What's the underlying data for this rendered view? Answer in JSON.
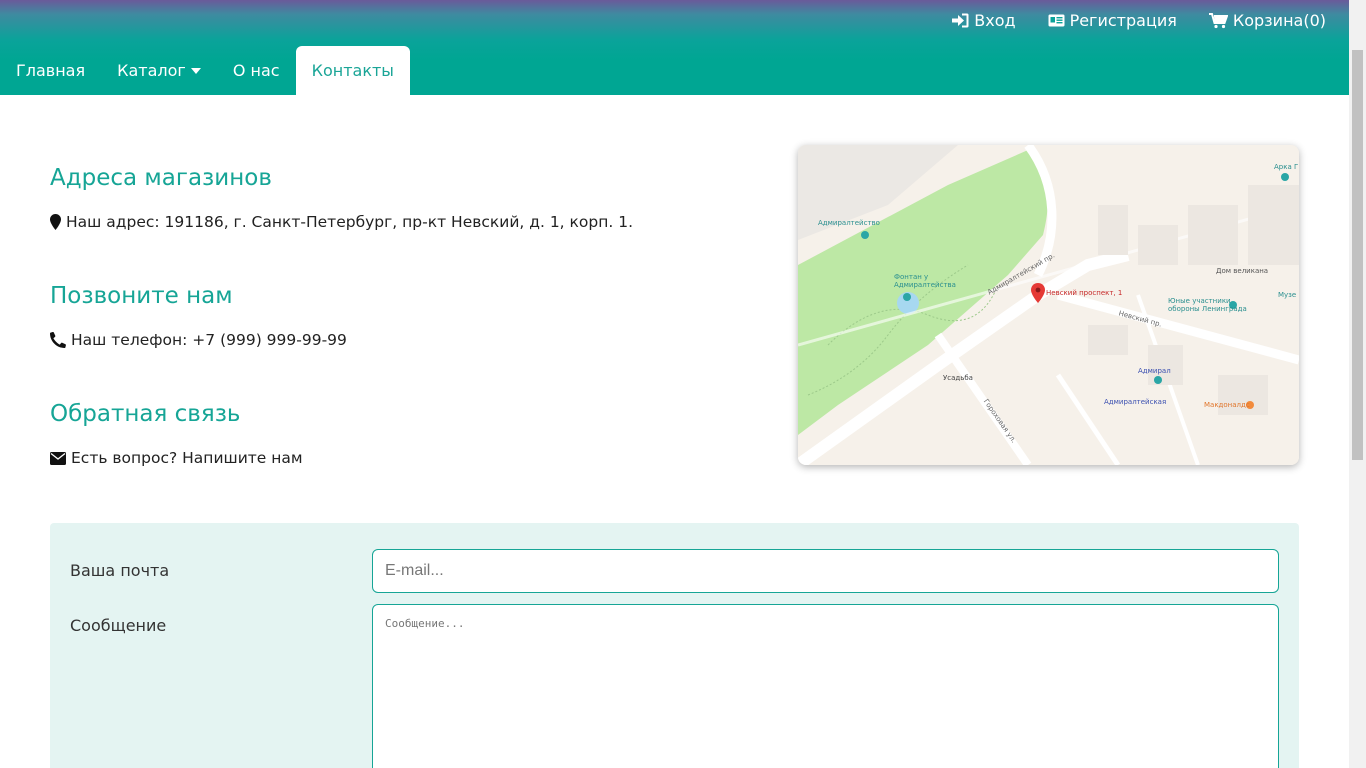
{
  "header": {
    "top_links": {
      "login": "Вход",
      "register": "Регистрация",
      "cart": "Корзина(0)"
    },
    "nav": {
      "home": "Главная",
      "catalog": "Каталог",
      "about": "О нас",
      "contacts": "Контакты"
    }
  },
  "contacts": {
    "addresses_title": "Адреса магазинов",
    "address_text": "Наш адрес: 191186, г. Санкт-Петербург, пр-кт Невский, д. 1, корп. 1.",
    "call_title": "Позвоните нам",
    "phone_text": "Наш телефон: +7 (999) 999-99-99",
    "feedback_title": "Обратная связь",
    "feedback_text": "Есть вопрос? Напишите нам"
  },
  "map": {
    "labels": {
      "admiralteistvo": "Адмиралтейство",
      "fountain": "Фонтан у Адмиралтейства",
      "nevsky_1": "Невский проспект, 1",
      "veterans": "Юные участники обороны Ленинграда",
      "dom_velikana": "Дом великана",
      "uzaditsa": "Усадьба",
      "admiral": "Адмирал",
      "admiralteiskaya": "Адмиралтейская",
      "mcdonalds": "Макдоналдс",
      "nevsky_pr": "Невский пр.",
      "admiralteisky_pr": "Адмиралтейский пр.",
      "gorokhovaya": "Гороховая ул.",
      "arka": "Арка Г",
      "muzei": "Музе"
    }
  },
  "form": {
    "email_label": "Ваша почта",
    "email_placeholder": "E-mail...",
    "message_label": "Сообщение",
    "message_placeholder": "Сообщение..."
  },
  "colors": {
    "accent": "#00a693",
    "title": "#16a596",
    "form_bg": "#e4f4f2"
  }
}
